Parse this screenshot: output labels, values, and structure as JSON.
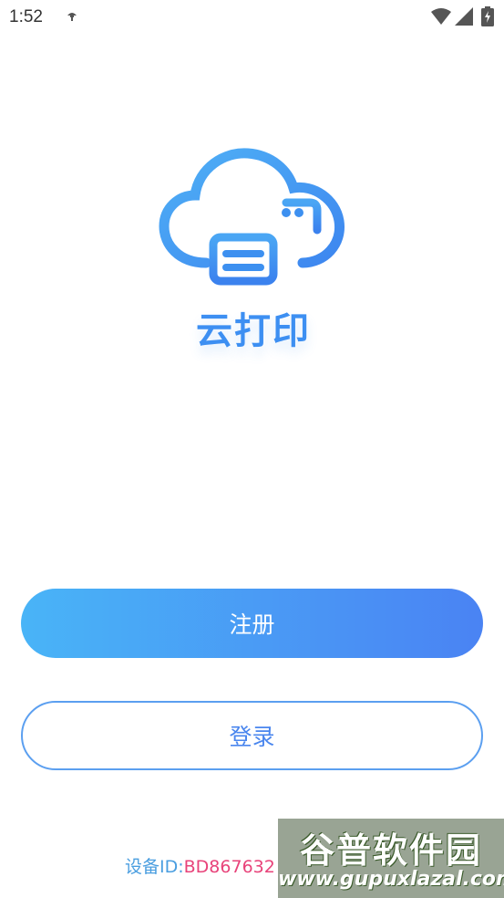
{
  "status_bar": {
    "time": "1:52",
    "icons": [
      "notification-icon",
      "wifi-icon",
      "signal-icon",
      "battery-icon"
    ]
  },
  "logo": {
    "app_name": "云打印",
    "icon": "cloud-printer-icon"
  },
  "buttons": {
    "register_label": "注册",
    "login_label": "登录"
  },
  "device": {
    "label": "设备ID:",
    "value": "BD867632"
  },
  "watermark": {
    "title": "谷普软件园",
    "url": "www.gupuxlazal.com"
  },
  "colors": {
    "accent_blue": "#4a86ee",
    "gradient_start": "#49b4f7",
    "gradient_end": "#4a83f3",
    "device_value": "#e8437a"
  }
}
